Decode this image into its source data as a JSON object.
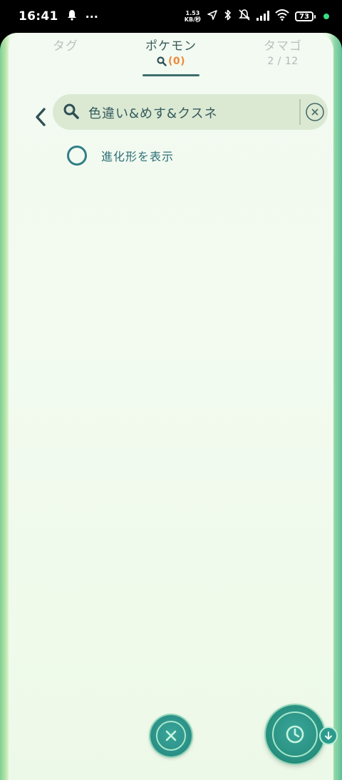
{
  "status_bar": {
    "time": "16:41",
    "more": "···",
    "net_speed_value": "1.53",
    "net_speed_unit": "KB/秒",
    "battery": "73"
  },
  "tabs": {
    "tag": {
      "label": "タグ"
    },
    "pokemon": {
      "label": "ポケモン",
      "count": "(0)"
    },
    "egg": {
      "label": "タマゴ",
      "count": "2 / 12"
    }
  },
  "search": {
    "query": "色違い&めす&クスネ"
  },
  "options": {
    "show_evolutions_label": "進化形を表示"
  },
  "colors": {
    "accent": "#2f7f86",
    "count_highlight": "#f08a3c",
    "fab": "#2a8f86"
  }
}
